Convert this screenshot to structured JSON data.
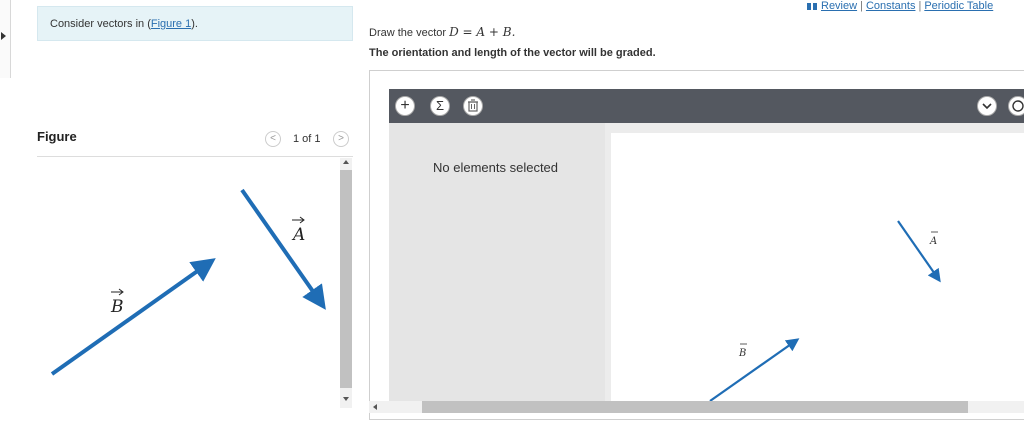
{
  "prompt": {
    "text_before": "Consider vectors in (",
    "link": "Figure 1",
    "text_after": ")."
  },
  "figure": {
    "title": "Figure",
    "pager": "1 of 1",
    "prev_glyph": "<",
    "next_glyph": ">",
    "label_a": "A",
    "label_b": "B"
  },
  "resources": {
    "review": "Review",
    "constants": "Constants",
    "periodic_table": "Periodic Table",
    "separator": "|"
  },
  "question": {
    "draw_prefix": "Draw the vector",
    "equation": "D = A + B.",
    "graded": "The orientation and length of the vector will be graded."
  },
  "tool": {
    "add_glyph": "+",
    "sigma_glyph": "Σ",
    "status": "No elements selected",
    "canvas_label_a": "A",
    "canvas_label_b": "B"
  },
  "colors": {
    "vector": "#1f6db5",
    "toolbar": "#545860",
    "link": "#2a6fb0"
  }
}
